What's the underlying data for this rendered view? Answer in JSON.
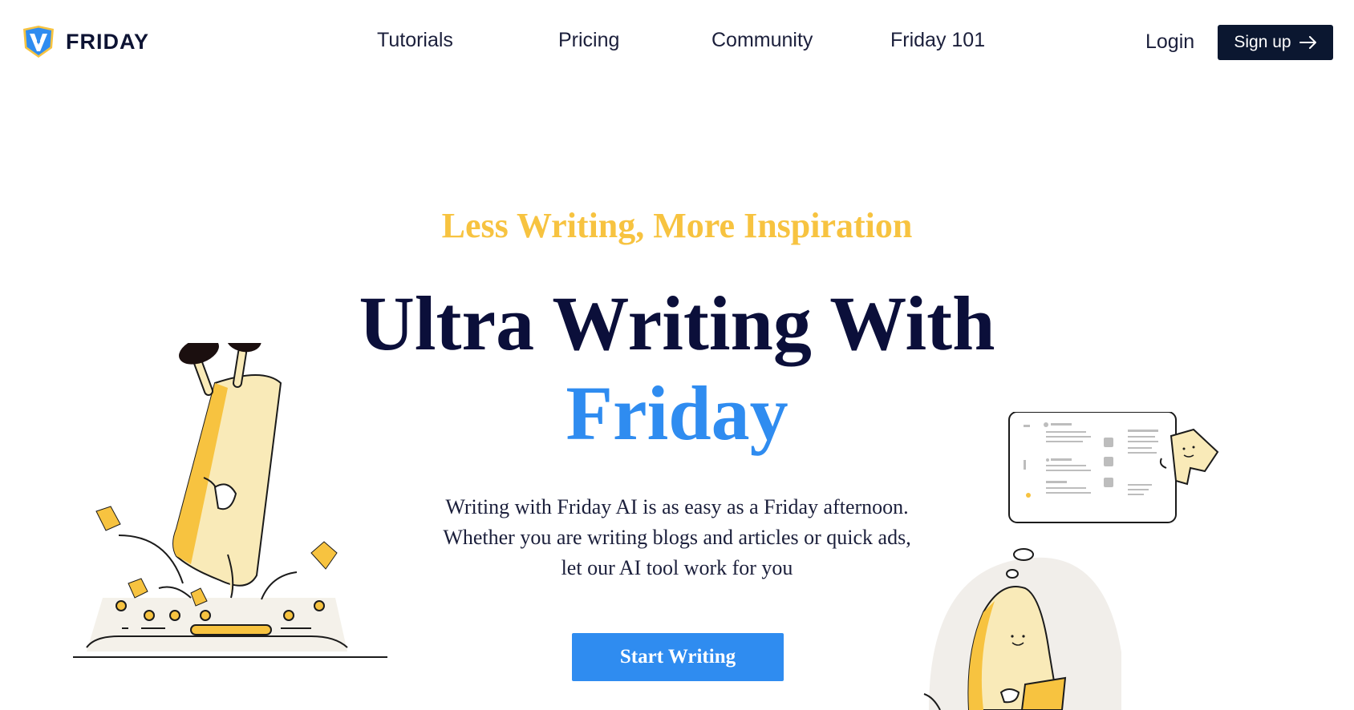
{
  "brand": {
    "name": "FRIDAY",
    "logo_icon": "friday-logo-icon"
  },
  "nav": {
    "items": [
      {
        "label": "Tutorials"
      },
      {
        "label": "Pricing"
      },
      {
        "label": "Community"
      },
      {
        "label": "Friday 101"
      }
    ]
  },
  "auth": {
    "login_label": "Login",
    "signup_label": "Sign up",
    "signup_icon": "arrow-right-icon"
  },
  "hero": {
    "tagline": "Less Writing, More Inspiration",
    "title_line1": "Ultra Writing With",
    "title_line2": "Friday",
    "description": [
      "Writing with Friday AI is as easy as a Friday afternoon.",
      "Whether you are writing blogs and articles or quick ads,",
      "let our AI tool work for you"
    ],
    "cta_label": "Start Writing"
  },
  "illustrations": {
    "left": "pen-character-handstand-illustration",
    "right": "character-thinking-document-illustration"
  },
  "colors": {
    "brand_dark": "#0b1730",
    "accent_blue": "#2f8cf0",
    "accent_yellow": "#f7c340",
    "title_navy": "#0b0f3a"
  }
}
